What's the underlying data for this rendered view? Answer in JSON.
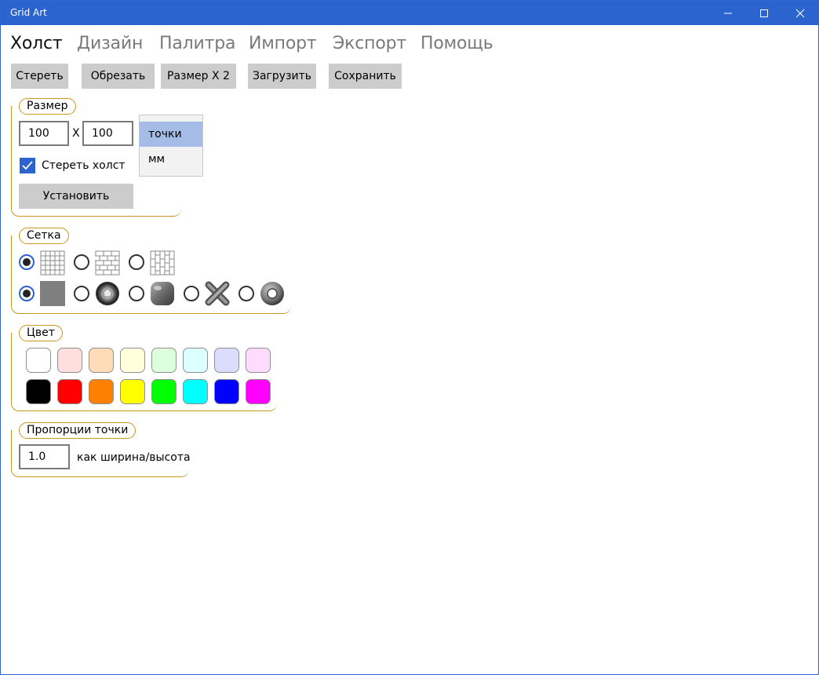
{
  "window": {
    "title": "Grid Art"
  },
  "tabs": [
    {
      "label": "Холст",
      "active": true
    },
    {
      "label": "Дизайн",
      "active": false
    },
    {
      "label": "Палитра",
      "active": false
    },
    {
      "label": "Импорт",
      "active": false
    },
    {
      "label": "Экспорт",
      "active": false
    },
    {
      "label": "Помощь",
      "active": false
    }
  ],
  "toolbar": {
    "erase_label": "Стереть",
    "crop_label": "Обрезать",
    "size_x2_label": "Размер X 2",
    "load_label": "Загрузить",
    "save_label": "Сохранить"
  },
  "size_group": {
    "legend": "Размер",
    "width_value": "100",
    "separator": "X",
    "height_value": "100",
    "units": [
      {
        "label": "точки",
        "selected": true
      },
      {
        "label": "мм",
        "selected": false
      }
    ],
    "clear_canvas_label": "Стереть холст",
    "clear_canvas_checked": true,
    "apply_label": "Установить"
  },
  "grid_group": {
    "legend": "Сетка",
    "layout_options": [
      {
        "icon": "square-grid-icon",
        "checked": true
      },
      {
        "icon": "brick-horizontal-grid-icon",
        "checked": false
      },
      {
        "icon": "brick-vertical-grid-icon",
        "checked": false
      }
    ],
    "shape_options": [
      {
        "icon": "flat-square-tile-icon",
        "checked": true
      },
      {
        "icon": "rhinestone-icon",
        "checked": false
      },
      {
        "icon": "rounded-tile-icon",
        "checked": false
      },
      {
        "icon": "cross-stitch-icon",
        "checked": false
      },
      {
        "icon": "ring-bead-icon",
        "checked": false
      }
    ]
  },
  "color_group": {
    "legend": "Цвет",
    "light_colors": [
      "#ffffff",
      "#ffdede",
      "#ffdcb8",
      "#ffffdc",
      "#dcffdc",
      "#dcffff",
      "#dcdcff",
      "#ffdcff"
    ],
    "bright_colors": [
      "#000000",
      "#ff0000",
      "#ff8000",
      "#ffff00",
      "#00ff00",
      "#00ffff",
      "#0000ff",
      "#ff00ff"
    ]
  },
  "ratio_group": {
    "legend": "Пропорции точки",
    "value": "1.0",
    "caption": "как ширина/высота"
  },
  "colors": {
    "titlebar": "#2b63cf",
    "accent_border": "#c9961f",
    "button_bg": "#cccccc",
    "selected_unit": "#a5bce6"
  }
}
